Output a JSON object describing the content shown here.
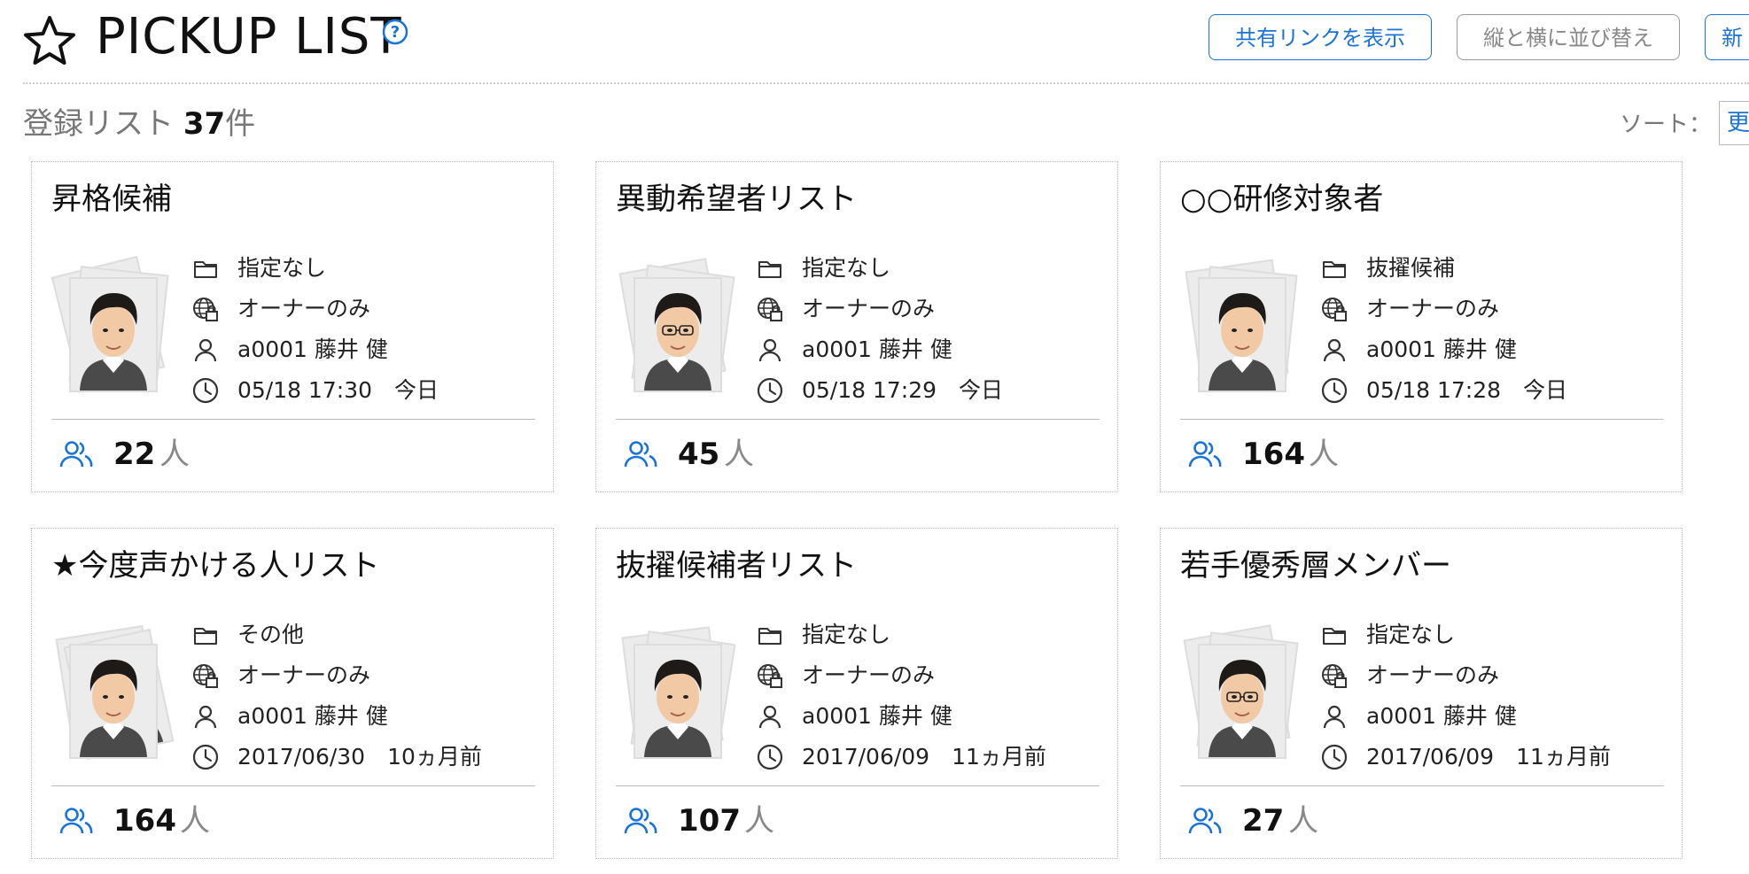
{
  "header": {
    "title": "PICKUP LIST",
    "buttons": {
      "share": "共有リンクを表示",
      "reorder": "縦と横に並び替え",
      "new": "新"
    }
  },
  "summary": {
    "prefix": "登録リスト",
    "count": "37",
    "suffix": "件"
  },
  "sort": {
    "label": "ソート：",
    "value": "更"
  },
  "cards": [
    {
      "title": "昇格候補",
      "folder": "指定なし",
      "visibility": "オーナーのみ",
      "owner": "a0001 藤井 健",
      "updated": "05/18 17:30　今日",
      "members": "22",
      "unit": "人"
    },
    {
      "title": "異動希望者リスト",
      "folder": "指定なし",
      "visibility": "オーナーのみ",
      "owner": "a0001 藤井 健",
      "updated": "05/18 17:29　今日",
      "members": "45",
      "unit": "人"
    },
    {
      "title": "○○研修対象者",
      "folder": "抜擢候補",
      "visibility": "オーナーのみ",
      "owner": "a0001 藤井 健",
      "updated": "05/18 17:28　今日",
      "members": "164",
      "unit": "人"
    },
    {
      "title": "★今度声かける人リスト",
      "folder": "その他",
      "visibility": "オーナーのみ",
      "owner": "a0001 藤井 健",
      "updated": "2017/06/30　10ヵ月前",
      "members": "164",
      "unit": "人"
    },
    {
      "title": "抜擢候補者リスト",
      "folder": "指定なし",
      "visibility": "オーナーのみ",
      "owner": "a0001 藤井 健",
      "updated": "2017/06/09　11ヵ月前",
      "members": "107",
      "unit": "人"
    },
    {
      "title": "若手優秀層メンバー",
      "folder": "指定なし",
      "visibility": "オーナーのみ",
      "owner": "a0001 藤井 健",
      "updated": "2017/06/09　11ヵ月前",
      "members": "27",
      "unit": "人"
    }
  ],
  "colors": {
    "accent": "#1a73d6",
    "border": "#bdbdbd",
    "text_muted": "#777777"
  }
}
